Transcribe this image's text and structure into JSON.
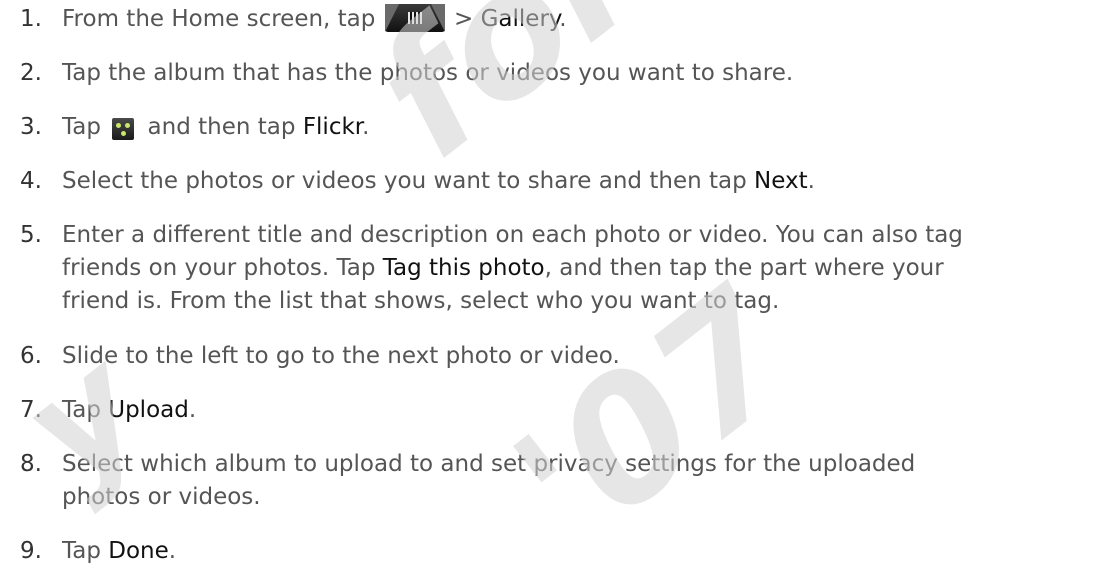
{
  "steps": [
    {
      "number": "1.",
      "pre": "From the Home screen, tap ",
      "icon": "all-apps-icon",
      "post": " > ",
      "bold1": "Gallery",
      "post2": "."
    },
    {
      "number": "2.",
      "text": "Tap the album that has the photos or videos you want to share."
    },
    {
      "number": "3.",
      "pre": "Tap ",
      "icon": "share-icon",
      "post": " and then tap ",
      "bold1": "Flickr",
      "post2": "."
    },
    {
      "number": "4.",
      "pre": "Select the photos or videos you want to share and then tap ",
      "bold1": "Next",
      "post2": "."
    },
    {
      "number": "5.",
      "line1": "Enter a different title and description on each photo or video. You can also tag",
      "line2_pre": "friends on your photos. Tap ",
      "line2_bold": "Tag this photo",
      "line2_post": ", and then tap the part where your",
      "line3": "friend is. From the list that shows, select who you want to tag."
    },
    {
      "number": "6.",
      "text": "Slide to the left to go to the next photo or video."
    },
    {
      "number": "7.",
      "pre": "Tap ",
      "bold1": "Upload",
      "post2": "."
    },
    {
      "number": "8.",
      "line1": "Select which album to upload to and set privacy settings for the uploaded",
      "line2": "photos or videos."
    },
    {
      "number": "9.",
      "pre": "Tap ",
      "bold1": "Done",
      "post2": "."
    }
  ],
  "watermark": [
    "for certi",
    "y",
    "'07"
  ]
}
